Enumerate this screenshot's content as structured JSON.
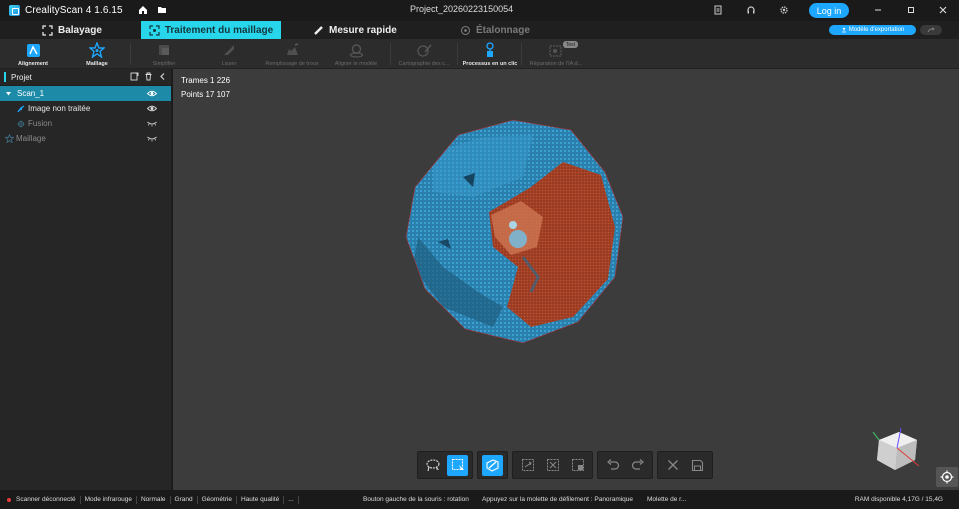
{
  "app": {
    "title": "CrealityScan 4 1.6.15",
    "project": "Project_20260223150054",
    "login_label": "Log in"
  },
  "tabs": [
    {
      "label": "Balayage",
      "state": "normal",
      "icon": "scan-frame-icon"
    },
    {
      "label": "Traitement du maillage",
      "state": "active",
      "icon": "mesh-process-icon"
    },
    {
      "label": "Mesure rapide",
      "state": "normal",
      "icon": "ruler-icon"
    },
    {
      "label": "Étalonnage",
      "state": "disabled",
      "icon": "target-icon"
    }
  ],
  "export_label": "Modèle d'exportation",
  "toolbar": {
    "items": [
      {
        "label": "Alignement",
        "enabled": true
      },
      {
        "label": "Maillage",
        "enabled": true
      },
      {
        "label": "Simplifier",
        "enabled": false
      },
      {
        "label": "Lisser",
        "enabled": false
      },
      {
        "label": "Remplissage de trous",
        "enabled": false
      },
      {
        "label": "Aligner le modèle",
        "enabled": false
      },
      {
        "label": "Cartographie des c...",
        "enabled": false
      },
      {
        "label": "Processus en un clic",
        "enabled": true
      },
      {
        "label": "Réparation de l'IA d...",
        "enabled": false
      }
    ],
    "test_badge": "Test"
  },
  "sidebar": {
    "title": "Projet",
    "items": [
      {
        "label": "Scan_1",
        "level": 0,
        "selected": true,
        "visible": true
      },
      {
        "label": "Image non traitée",
        "level": 1,
        "selected": false,
        "visible": true
      },
      {
        "label": "Fusion",
        "level": 1,
        "selected": false,
        "visible": false,
        "dim": true
      },
      {
        "label": "Maillage",
        "level": 0,
        "selected": false,
        "visible": false,
        "dim": true
      }
    ]
  },
  "viewport": {
    "frames_label": "Trames 1 226",
    "points_label": "Points 17 107",
    "colors": {
      "mesh_blue": "#2f8fc0",
      "mesh_red": "#b5472a",
      "background": "#3c3c3c"
    }
  },
  "statusbar": {
    "scanner_state": "Scanner déconnecté",
    "items": [
      "Mode infrarouge",
      "Normale",
      "Grand",
      "Géométrie",
      "Haute qualité",
      "..."
    ],
    "hint_left": "Bouton gauche de la souris : rotation",
    "hint_mid": "Appuyez sur la molette de défilement : Panoramique",
    "hint_right": "Molette de r...",
    "ram": "RAM disponible 4,17G / 15,4G"
  }
}
